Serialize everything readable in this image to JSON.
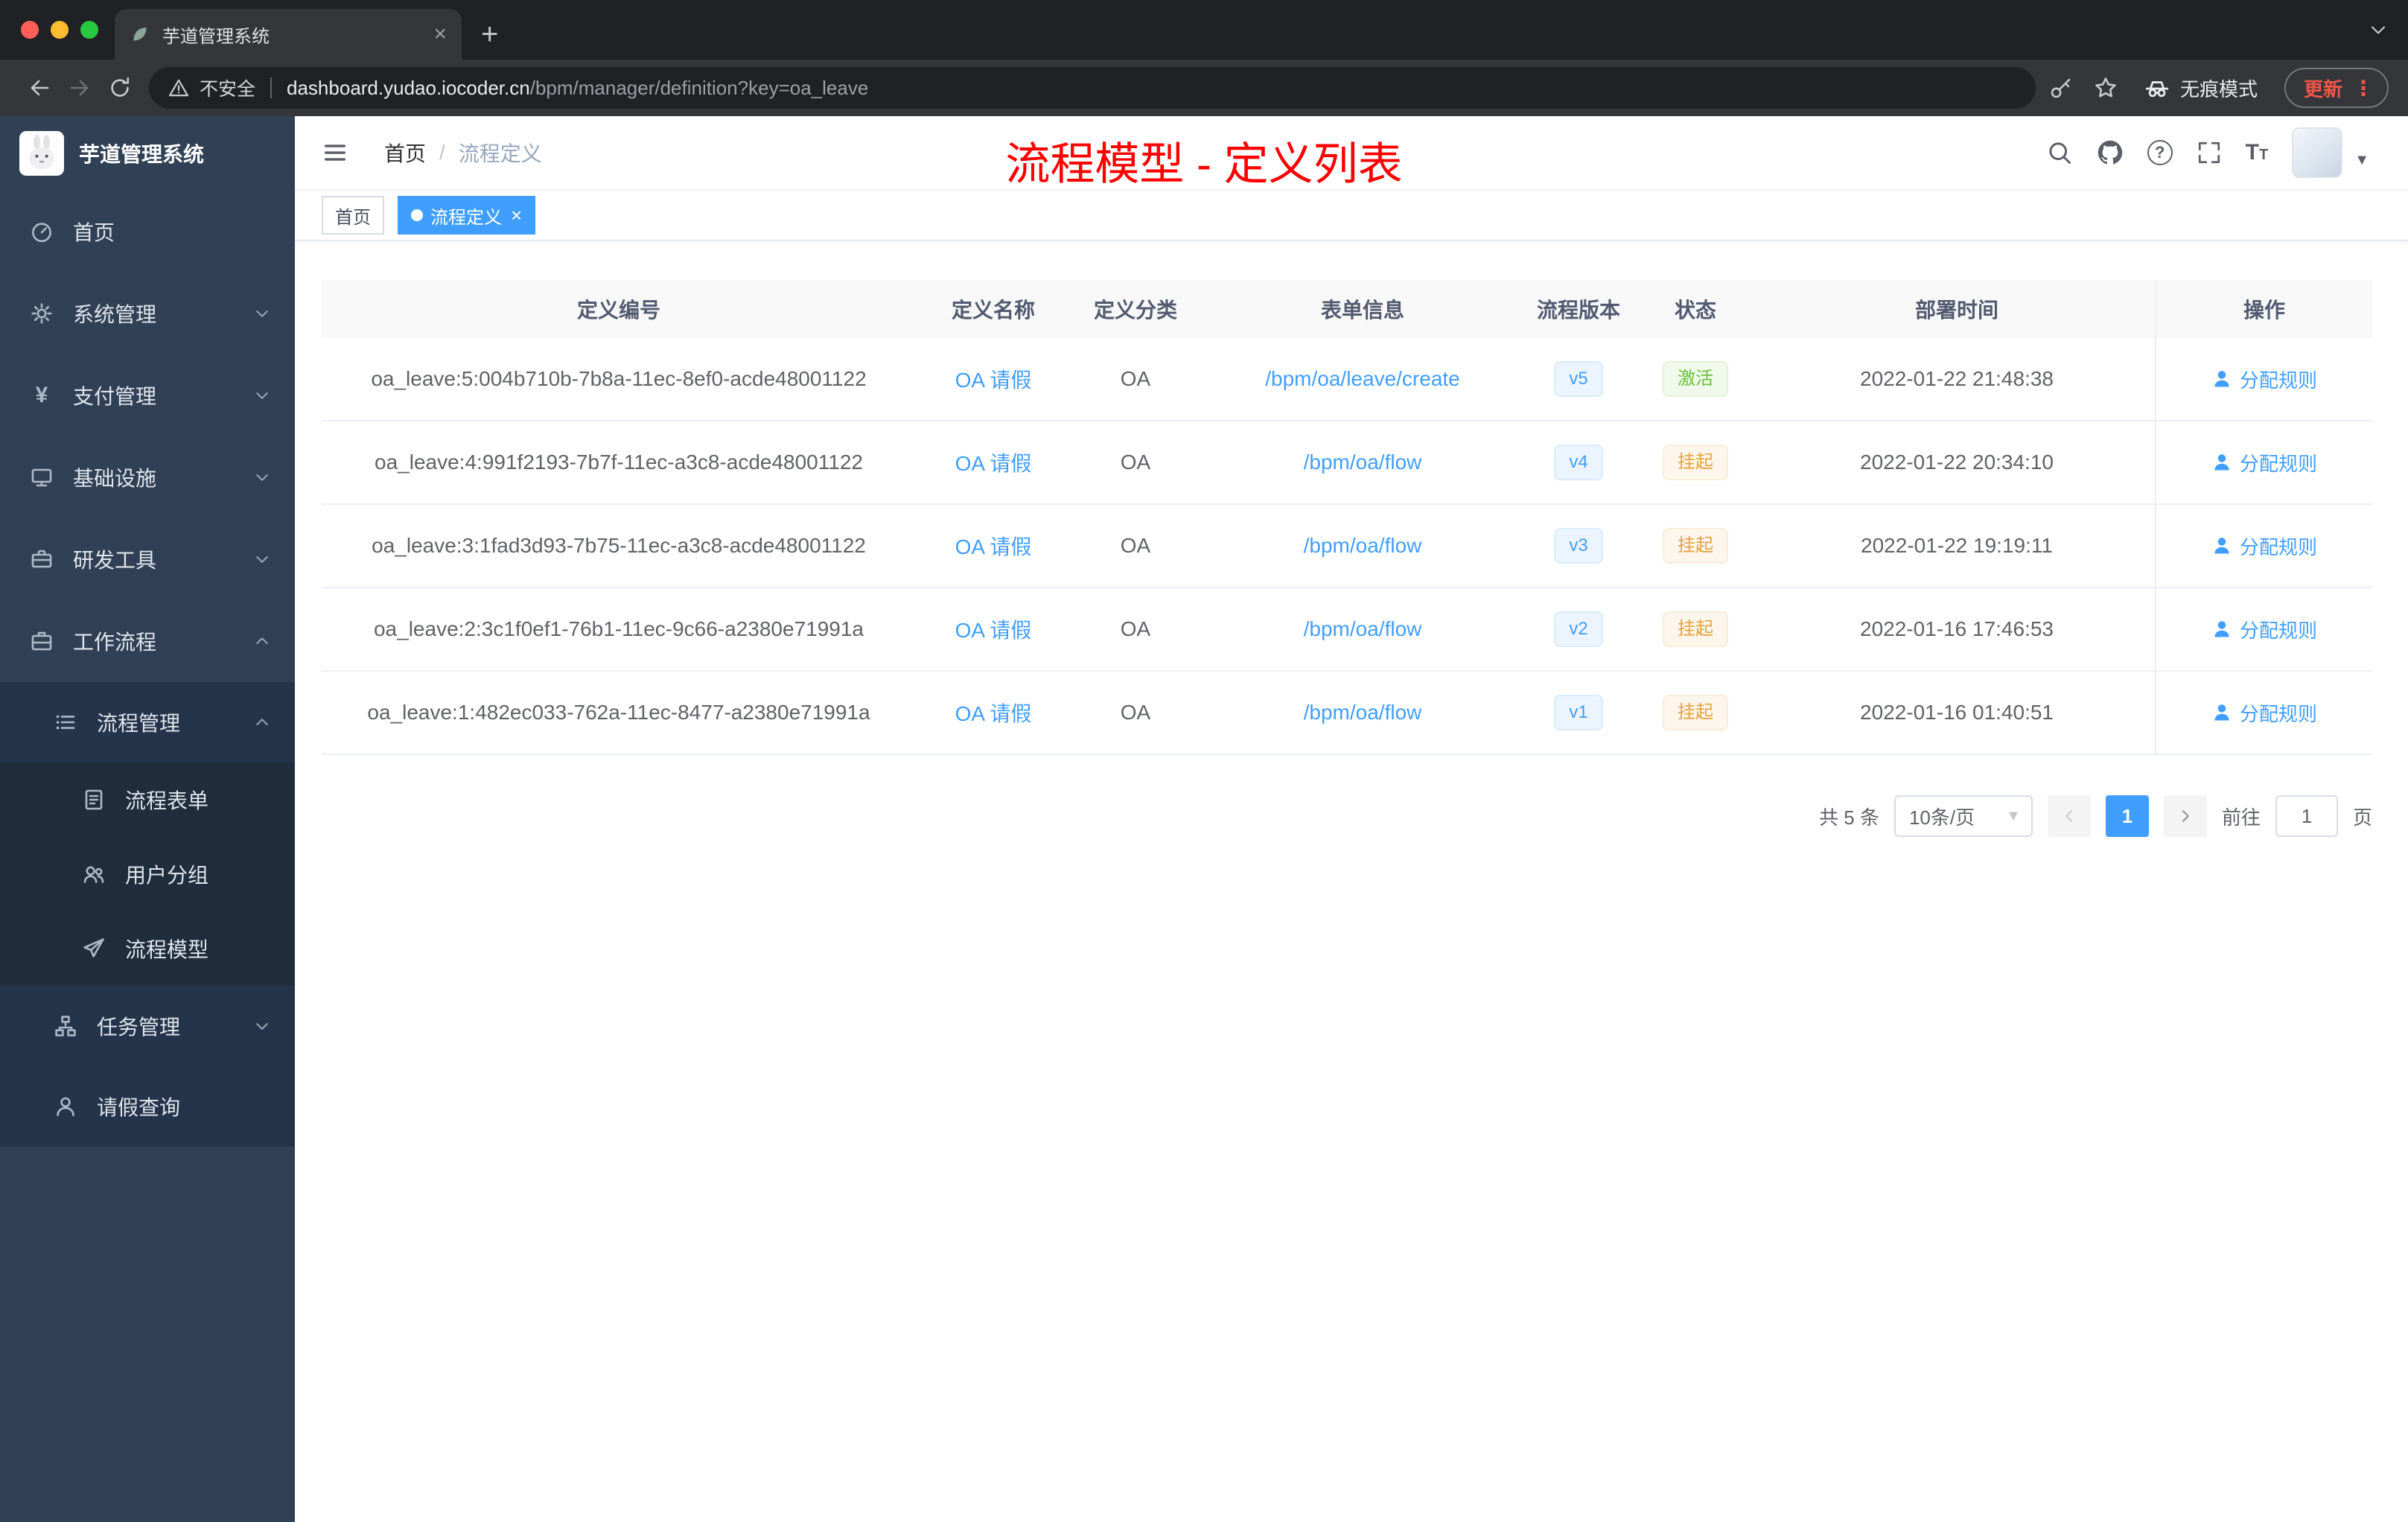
{
  "palette": {
    "accent": "#409eff",
    "annotation_red": "#fe0000",
    "success_green": "#67c23a",
    "warning_orange": "#e6a23c",
    "sidebar_bg": "#304156",
    "submenu_bg": "#24344a",
    "update_red": "#f4564a"
  },
  "browser": {
    "tab_title": "芋道管理系统",
    "security_label": "不安全",
    "url_host": "dashboard.yudao.iocoder.cn",
    "url_path": "/bpm/manager/definition?key=oa_leave",
    "incognito_label": "无痕模式",
    "update_label": "更新",
    "update_menu": "⋮",
    "new_tab_label": "+",
    "close_label": "×"
  },
  "sidebar": {
    "logo_title": "芋道管理系统",
    "menu": [
      {
        "label": "首页"
      },
      {
        "label": "系统管理"
      },
      {
        "label": "支付管理"
      },
      {
        "label": "基础设施"
      },
      {
        "label": "研发工具"
      },
      {
        "label": "工作流程"
      },
      {
        "label": "流程管理"
      },
      {
        "label": "流程表单"
      },
      {
        "label": "用户分组"
      },
      {
        "label": "流程模型"
      },
      {
        "label": "任务管理"
      },
      {
        "label": "请假查询"
      }
    ]
  },
  "navbar": {
    "breadcrumb_home": "首页",
    "breadcrumb_separator": "/",
    "breadcrumb_current": "流程定义",
    "annotation_title": "流程模型 - 定义列表"
  },
  "tags": {
    "home": "首页",
    "active": "流程定义",
    "close": "×"
  },
  "table": {
    "columns": [
      "定义编号",
      "定义名称",
      "定义分类",
      "表单信息",
      "流程版本",
      "状态",
      "部署时间",
      "操作"
    ],
    "rows": [
      {
        "id": "oa_leave:5:004b710b-7b8a-11ec-8ef0-acde48001122",
        "name": "OA 请假",
        "category": "OA",
        "form": "/bpm/oa/leave/create",
        "version": "v5",
        "status": "激活",
        "deploy_time": "2022-01-22 21:48:38",
        "action": "分配规则"
      },
      {
        "id": "oa_leave:4:991f2193-7b7f-11ec-a3c8-acde48001122",
        "name": "OA 请假",
        "category": "OA",
        "form": "/bpm/oa/flow",
        "version": "v4",
        "status": "挂起",
        "deploy_time": "2022-01-22 20:34:10",
        "action": "分配规则"
      },
      {
        "id": "oa_leave:3:1fad3d93-7b75-11ec-a3c8-acde48001122",
        "name": "OA 请假",
        "category": "OA",
        "form": "/bpm/oa/flow",
        "version": "v3",
        "status": "挂起",
        "deploy_time": "2022-01-22 19:19:11",
        "action": "分配规则"
      },
      {
        "id": "oa_leave:2:3c1f0ef1-76b1-11ec-9c66-a2380e71991a",
        "name": "OA 请假",
        "category": "OA",
        "form": "/bpm/oa/flow",
        "version": "v2",
        "status": "挂起",
        "deploy_time": "2022-01-16 17:46:53",
        "action": "分配规则"
      },
      {
        "id": "oa_leave:1:482ec033-762a-11ec-8477-a2380e71991a",
        "name": "OA 请假",
        "category": "OA",
        "form": "/bpm/oa/flow",
        "version": "v1",
        "status": "挂起",
        "deploy_time": "2022-01-16 01:40:51",
        "action": "分配规则"
      }
    ]
  },
  "pagination": {
    "total": "共 5 条",
    "page_size": "10条/页",
    "current_page": "1",
    "goto_label": "前往",
    "goto_value": "1",
    "unit_label": "页"
  }
}
